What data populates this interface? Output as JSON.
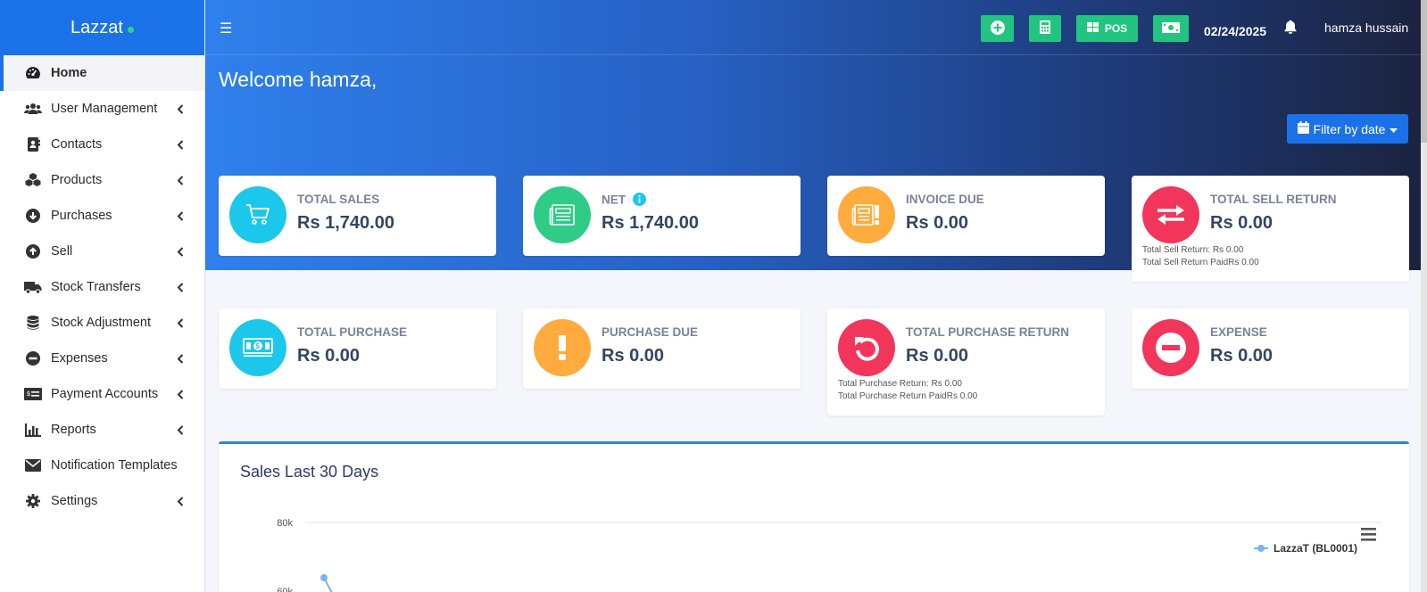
{
  "brand": {
    "name": "Lazzat",
    "status_color": "#2dd47f"
  },
  "sidebar": {
    "items": [
      {
        "label": "Home",
        "icon": "dashboard-icon",
        "active": true,
        "has_children": false
      },
      {
        "label": "User Management",
        "icon": "users-icon",
        "has_children": true
      },
      {
        "label": "Contacts",
        "icon": "address-book-icon",
        "has_children": true
      },
      {
        "label": "Products",
        "icon": "cubes-icon",
        "has_children": true
      },
      {
        "label": "Purchases",
        "icon": "arrow-circle-down-icon",
        "has_children": true
      },
      {
        "label": "Sell",
        "icon": "arrow-circle-up-icon",
        "has_children": true
      },
      {
        "label": "Stock Transfers",
        "icon": "truck-icon",
        "has_children": true
      },
      {
        "label": "Stock Adjustment",
        "icon": "database-icon",
        "has_children": true
      },
      {
        "label": "Expenses",
        "icon": "minus-circle-icon",
        "has_children": true
      },
      {
        "label": "Payment Accounts",
        "icon": "money-check-icon",
        "has_children": true
      },
      {
        "label": "Reports",
        "icon": "bar-chart-icon",
        "has_children": true
      },
      {
        "label": "Notification Templates",
        "icon": "envelope-icon",
        "has_children": false
      },
      {
        "label": "Settings",
        "icon": "gear-icon",
        "has_children": true
      }
    ]
  },
  "topbar": {
    "pos_label": "POS",
    "date": "02/24/2025",
    "user_name": "hamza hussain",
    "accent": "#22c57f"
  },
  "welcome": "Welcome hamza,",
  "filter_label": "Filter by date",
  "cards": {
    "total_sales": {
      "label": "TOTAL SALES",
      "value": "Rs 1,740.00",
      "color": "#1cc7ec"
    },
    "net": {
      "label": "NET",
      "value": "Rs 1,740.00",
      "color": "#2ecc87"
    },
    "invoice_due": {
      "label": "INVOICE DUE",
      "value": "Rs 0.00",
      "color": "#ffab3d"
    },
    "total_sell_return": {
      "label": "TOTAL SELL RETURN",
      "value": "Rs 0.00",
      "color": "#f2355b",
      "line1": "Total Sell Return: Rs 0.00",
      "line2": "Total Sell Return PaidRs 0.00"
    },
    "total_purchase": {
      "label": "TOTAL PURCHASE",
      "value": "Rs 0.00",
      "color": "#1cc7ec"
    },
    "purchase_due": {
      "label": "PURCHASE DUE",
      "value": "Rs 0.00",
      "color": "#ffab3d"
    },
    "total_purchase_return": {
      "label": "TOTAL PURCHASE RETURN",
      "value": "Rs 0.00",
      "color": "#f2355b",
      "line1": "Total Purchase Return: Rs 0.00",
      "line2": "Total Purchase Return PaidRs 0.00"
    },
    "expense": {
      "label": "EXPENSE",
      "value": "Rs 0.00",
      "color": "#f2355b"
    }
  },
  "chart": {
    "title": "Sales Last 30 Days",
    "y_ticks": [
      "80k",
      "60k"
    ],
    "legend": "LazzaT (BL0001)",
    "series_color": "#7cb5ec"
  }
}
